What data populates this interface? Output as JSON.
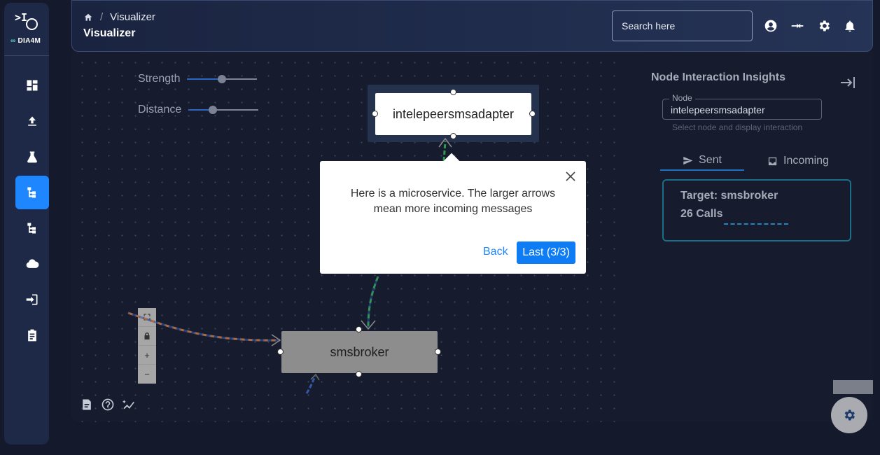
{
  "app": {
    "brand": "DIA4M"
  },
  "sidebar": {
    "items": [
      {
        "icon": "dashboard-icon"
      },
      {
        "icon": "upload-icon"
      },
      {
        "icon": "flask-icon"
      },
      {
        "icon": "hierarchy-icon",
        "active": true
      },
      {
        "icon": "tree-icon"
      },
      {
        "icon": "cloud-icon"
      },
      {
        "icon": "login-icon"
      },
      {
        "icon": "clipboard-icon"
      }
    ]
  },
  "header": {
    "breadcrumb": "Visualizer",
    "title": "Visualizer",
    "search_placeholder": "Search here"
  },
  "canvas": {
    "strength_label": "Strength",
    "distance_label": "Distance",
    "strength_value": 0.5,
    "distance_value": 0.35,
    "nodes": {
      "selected": "intelepeersmsadapter",
      "other": "smsbroker"
    },
    "controls": [
      "fit-view",
      "lock",
      "+",
      "−"
    ]
  },
  "tour": {
    "message": "Here is a microservice. The larger arrows mean more incoming messages",
    "back_label": "Back",
    "next_label": "Last (3/3)"
  },
  "insights": {
    "title": "Node Interaction Insights",
    "node_legend": "Node",
    "node_value": "intelepeersmsadapter",
    "helper": "Select node and display interaction",
    "tabs": {
      "sent": "Sent",
      "incoming": "Incoming"
    },
    "card": {
      "target": "Target: smsbroker",
      "calls": "26 Calls"
    }
  },
  "colors": {
    "accent": "#1e86ff",
    "edge_orange": "#b06a3a",
    "edge_green": "#2e9a4e",
    "edge_blue": "#3557a8"
  }
}
